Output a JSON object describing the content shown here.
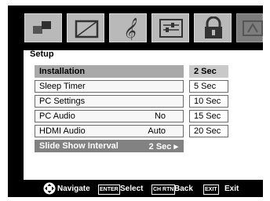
{
  "menu": {
    "title": "Setup",
    "header": "Installation",
    "items": [
      {
        "label": "Sleep Timer",
        "value": ""
      },
      {
        "label": "PC Settings",
        "value": ""
      },
      {
        "label": "PC Audio",
        "value": "No"
      },
      {
        "label": "HDMI Audio",
        "value": "Auto"
      },
      {
        "label": "Slide Show Interval",
        "value": "2 Sec ▸"
      }
    ]
  },
  "options": [
    "2 Sec",
    "5 Sec",
    "10 Sec",
    "15 Sec",
    "20 Sec"
  ],
  "selected_option": "2 Sec",
  "tabs": [
    "picture-tab",
    "display-tab",
    "audio-tab",
    "preferences-tab",
    "locks-tab",
    "setup-tab"
  ],
  "help": {
    "navigate": "Navigate",
    "enter_key": "ENTER",
    "select": "Select",
    "ch_rtn_key": "CH RTN",
    "back": "Back",
    "exit_key": "EXIT",
    "exit": "Exit"
  },
  "colors": {
    "background": "#000000",
    "panel": "#ffffff",
    "header_row": "#a9a9a9",
    "selected_row": "#828282",
    "selected_option": "#c9c9c9",
    "tab": "#b9b9b9"
  }
}
